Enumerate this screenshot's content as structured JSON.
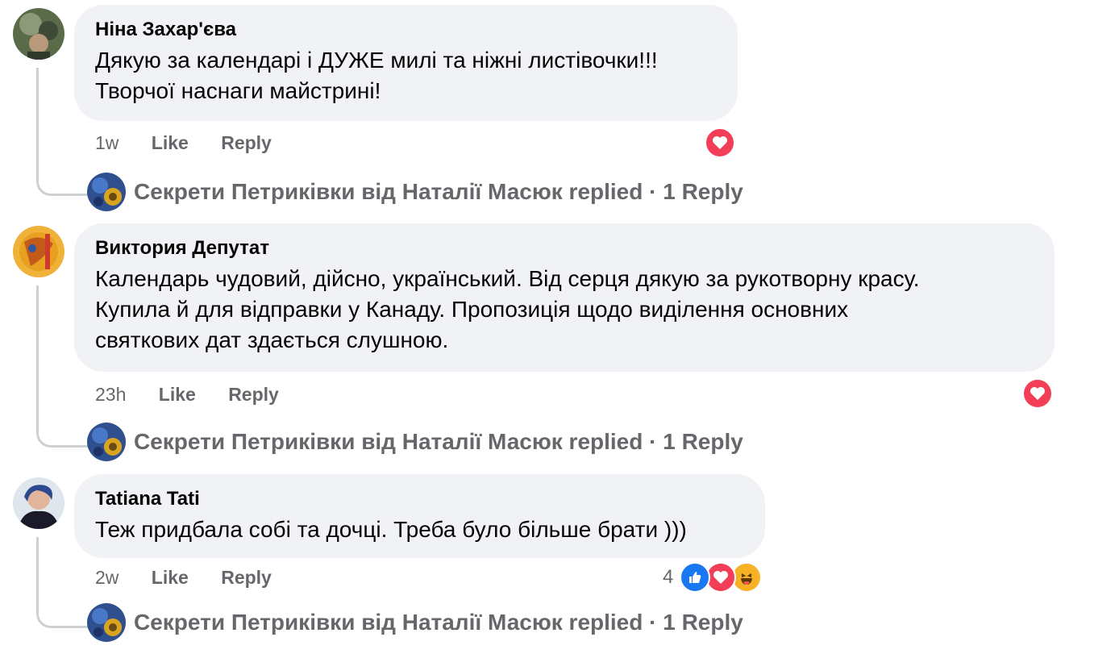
{
  "comments": [
    {
      "author": "Ніна Захар'єва",
      "lines": [
        "Дякую за календарі і ДУЖЕ милі та ніжні листівочки!!!",
        "Творчої наснаги майстрині!"
      ],
      "time": "1w",
      "like": "Like",
      "reply": "Reply",
      "reaction_count": "",
      "reactions": [
        "love"
      ],
      "replied_text": "Секрети Петриківки від Наталії Масюк replied · 1 Reply"
    },
    {
      "author": "Виктория Депутат",
      "lines": [
        "Календарь чудовий, дійсно, український. Від серця дякую за рукотворну красу.",
        "Купила й для відправки у Канаду. Пропозиція щодо виділення основних",
        "святкових дат здається слушною."
      ],
      "time": "23h",
      "like": "Like",
      "reply": "Reply",
      "reaction_count": "",
      "reactions": [
        "love"
      ],
      "replied_text": "Секрети Петриківки від Наталії Масюк replied · 1 Reply"
    },
    {
      "author": "Tatiana Tati",
      "lines": [
        "Теж придбала собі та дочці. Треба було більше брати )))"
      ],
      "time": "2w",
      "like": "Like",
      "reply": "Reply",
      "reaction_count": "4",
      "reactions": [
        "like",
        "love",
        "haha"
      ],
      "replied_text": "Секрети Петриківки від Наталії Масюк replied · 1 Reply"
    }
  ],
  "colors": {
    "bubble": "#f0f2f5",
    "meta": "#65676b",
    "love": "#f33e58",
    "like": "#1877f2",
    "haha": "#f7b125"
  }
}
